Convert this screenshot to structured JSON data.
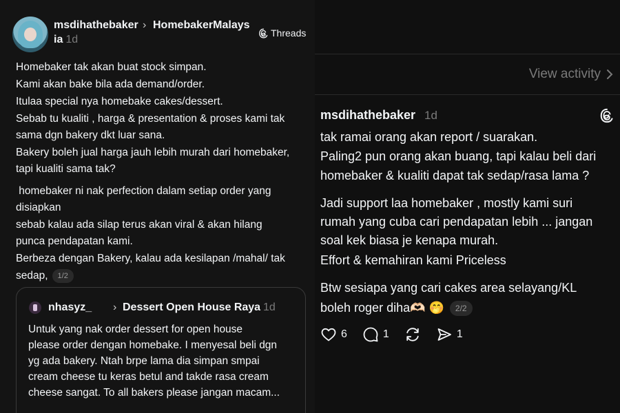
{
  "left_post": {
    "username": "msdihathebaker",
    "group_name_part1": "HomebakerMalays",
    "group_name_part2": "ia",
    "time": "1d",
    "threads_label": "Threads",
    "paragraphs": [
      "Homebaker tak akan buat stock simpan.",
      "Kami akan bake bila ada demand/order.",
      "Itulaa special nya homebake cakes/dessert.",
      "Sebab tu kualiti , harga & presentation & proses kami tak",
      "sama dgn bakery dkt luar sana.",
      "Bakery boleh jual harga jauh lebih murah dari homebaker,",
      "tapi kualiti sama tak?",
      " homebaker ni nak perfection dalam setiap order yang",
      "disiapkan",
      "sebab kalau ada silap terus akan viral & akan hilang",
      "punca pendapatan kami.",
      "Berbeza dengan Bakery, kalau ada kesilapan /mahal/ tak",
      "sedap,"
    ],
    "page_indicator": "1/2"
  },
  "quote": {
    "username": "nhasyz_",
    "group_name": "Dessert Open House Raya",
    "time": "1d",
    "lines": [
      "Untuk yang nak order dessert for open house",
      "please order dengan homebake. I menyesal beli dgn",
      "yg ada bakery. Ntah brpe lama dia simpan smpai",
      "cream cheese tu keras betul and takde rasa cream",
      "cheese sangat. To all bakers please jangan macam..."
    ]
  },
  "right_post": {
    "view_activity": "View activity",
    "username": "msdihathebaker",
    "time": "1d",
    "lines": [
      "tak ramai orang akan report / suarakan.",
      "Paling2 pun orang akan buang, tapi kalau beli dari",
      "homebaker & kualiti dapat tak sedap/rasa lama ?",
      "Jadi support laa homebaker , mostly kami suri",
      "rumah yang cuba cari pendapatan lebih ... jangan",
      "soal kek biasa je kenapa murah.",
      "Effort & kemahiran kami Priceless",
      "Btw sesiapa yang cari cakes area selayang/KL",
      "boleh roger diha🫶🏻 🤭"
    ],
    "page_indicator": "2/2",
    "likes": "6",
    "replies": "1",
    "shares": "1"
  },
  "icons": {
    "threads": "threads-logo-icon",
    "chevron": "chevron-right-icon",
    "like": "heart-icon",
    "reply": "comment-icon",
    "repost": "repost-icon",
    "share": "send-icon"
  },
  "colors": {
    "background": "#101010",
    "text": "#f3f5f7",
    "muted": "#7a7a7a",
    "border": "#3a3a3a"
  }
}
